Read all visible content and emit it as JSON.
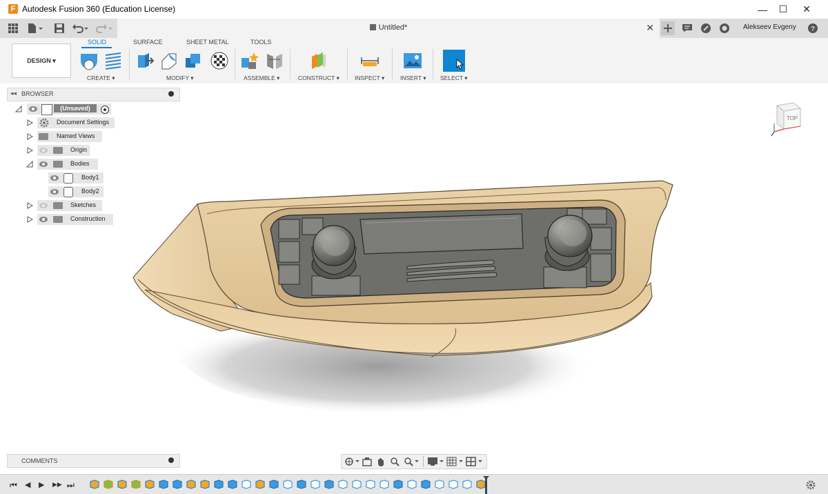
{
  "window": {
    "title": "Autodesk Fusion 360 (Education License)",
    "controls": {
      "minimize": "—",
      "maximize": "☐",
      "close": "✕"
    }
  },
  "quick_access": {
    "tab_title": "Untitled*",
    "tab_close": "✕",
    "user_name": "Alekseev Evgeny",
    "icons": [
      "grid-icon",
      "file-icon",
      "save-icon",
      "undo-icon",
      "redo-icon",
      "add-tab-icon",
      "comment-icon",
      "job-status-icon",
      "clock-icon",
      "help-icon"
    ]
  },
  "ribbon": {
    "workspace_button": "DESIGN ▾",
    "tabs": [
      "SOLID",
      "SURFACE",
      "SHEET METAL",
      "TOOLS"
    ],
    "active_tab": "SOLID",
    "groups": [
      {
        "label": "CREATE ▾"
      },
      {
        "label": "MODIFY ▾"
      },
      {
        "label": "ASSEMBLE ▾"
      },
      {
        "label": "CONSTRUCT ▾"
      },
      {
        "label": "INSPECT ▾"
      },
      {
        "label": "INSERT ▾"
      },
      {
        "label": "SELECT ▾"
      }
    ]
  },
  "browser": {
    "header": "BROWSER",
    "root": "(Unsaved)",
    "items": [
      {
        "label": "Document Settings"
      },
      {
        "label": "Named Views"
      },
      {
        "label": "Origin"
      },
      {
        "label": "Bodies"
      },
      {
        "label": "Body1"
      },
      {
        "label": "Body2"
      },
      {
        "label": "Sketches"
      },
      {
        "label": "Construction"
      }
    ]
  },
  "comments": {
    "header": "COMMENTS"
  },
  "viewcube": {
    "face": "TOP"
  },
  "timeline": {
    "controls": [
      "⏮",
      "◀",
      "▶",
      "▶▶",
      "⏭"
    ],
    "feature_count": 29
  },
  "colors": {
    "accent": "#1a7bc7",
    "body_tan": "#e2c69b",
    "panel_gray": "#6e6e6b",
    "knob_gray": "#7a7a76"
  }
}
